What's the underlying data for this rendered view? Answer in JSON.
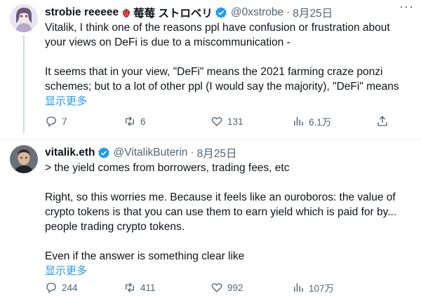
{
  "tweets": [
    {
      "name": "strobie reeeee",
      "name_suffix": "莓莓 ストロベリ",
      "handle": "@0xstrobe",
      "date": "8月25日",
      "body": [
        "Vitalik, I think one of the reasons ppl have confusion or frustration about",
        "your views on DeFi is due to a miscommunication -",
        "",
        "It seems that in your view, \"DeFi\" means the 2021 farming craze ponzi",
        "schemes; but to a lot of other ppl (I would say the majority), \"DeFi\" means"
      ],
      "show_more": "显示更多",
      "stats": {
        "replies": "7",
        "retweets": "6",
        "likes": "131",
        "views": "6.1万"
      }
    },
    {
      "name": "vitalik.eth",
      "handle": "@VitalikButerin",
      "date": "8月25日",
      "body": [
        "> the yield comes from borrowers, trading fees, etc",
        "",
        "Right, so this worries me. Because it feels like an ouroboros: the value of",
        "crypto tokens is that you can use them to earn yield which is paid for by...",
        "people trading crypto tokens.",
        "",
        "Even if the answer is something clear like"
      ],
      "show_more": "显示更多",
      "stats": {
        "replies": "244",
        "retweets": "411",
        "likes": "992",
        "views": "107万"
      }
    }
  ],
  "colors": {
    "link": "#1d9bf0",
    "secondary": "#536471",
    "text": "#0f1419",
    "verified": "#1d9bf0"
  }
}
